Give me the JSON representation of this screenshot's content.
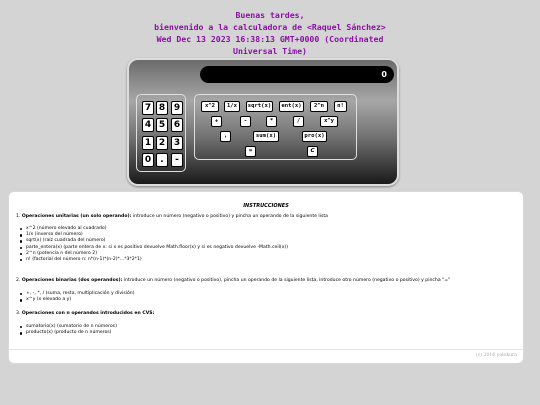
{
  "greeting": {
    "line1": "Buenas tardes,",
    "line2": "bienvenido a la calculadora de <Raquel Sánchez>",
    "line3": "Wed Dec 13 2023 16:38:13 GMT+0000 (Coordinated",
    "line4": "Universal Time)"
  },
  "calculator": {
    "display_value": "0",
    "numpad": [
      "7",
      "8",
      "9",
      "4",
      "5",
      "6",
      "1",
      "2",
      "3",
      "0",
      ".",
      "-"
    ],
    "ops_row1": [
      "x^2",
      "1/x",
      "sqrt(x)",
      "ent(x)",
      "2^n",
      "n!"
    ],
    "ops_row2": [
      "+",
      "-",
      "*",
      "/",
      "x^y"
    ],
    "ops_row3": [
      ",",
      "sum(x)",
      "pro(x)"
    ],
    "ops_row4": [
      "=",
      "C"
    ]
  },
  "instructions": {
    "title": "INSTRUCCIONES",
    "section1": {
      "number": "1.",
      "heading": "Operaciones unitarias (un solo operando):",
      "text": " introduce un número (negativo o positivo) y pincha un operando de la siguiente lista",
      "items": [
        "x^2 (número elevado al cuadrado)",
        "1/x (inverso del número)",
        "sqrt(x) (raíz cuadrada del número)",
        "parte_entera(x) (parte entera de x: si x es positivo devuelve Math.floor(x) y si es negativo devuelve -Math.ceil(x))",
        "2^n (potencia n del número 2)",
        "n! (factorial del número n: n*(n-1)*(n-2)*...*3*2*1)"
      ]
    },
    "section2": {
      "number": "2.",
      "heading": "Operaciones binarias (dos operandos):",
      "text": " introduce un número (negativo o positivo), pincha un operando de la siguiente lista, introduce otro número (negativo o positivo) y pincha \"=\"",
      "items": [
        "+, -, *, / (suma, resta, multiplicación y división)",
        "x^y (x elevado a y)"
      ]
    },
    "section3": {
      "number": "3.",
      "heading": "Operaciones con n operandos introducidos en CVS:",
      "items": [
        "sumatorio(x) (sumatorio de n números)",
        "producto(x) (producto de n números)"
      ]
    },
    "copyright": "(c) 2016 yolokura"
  }
}
